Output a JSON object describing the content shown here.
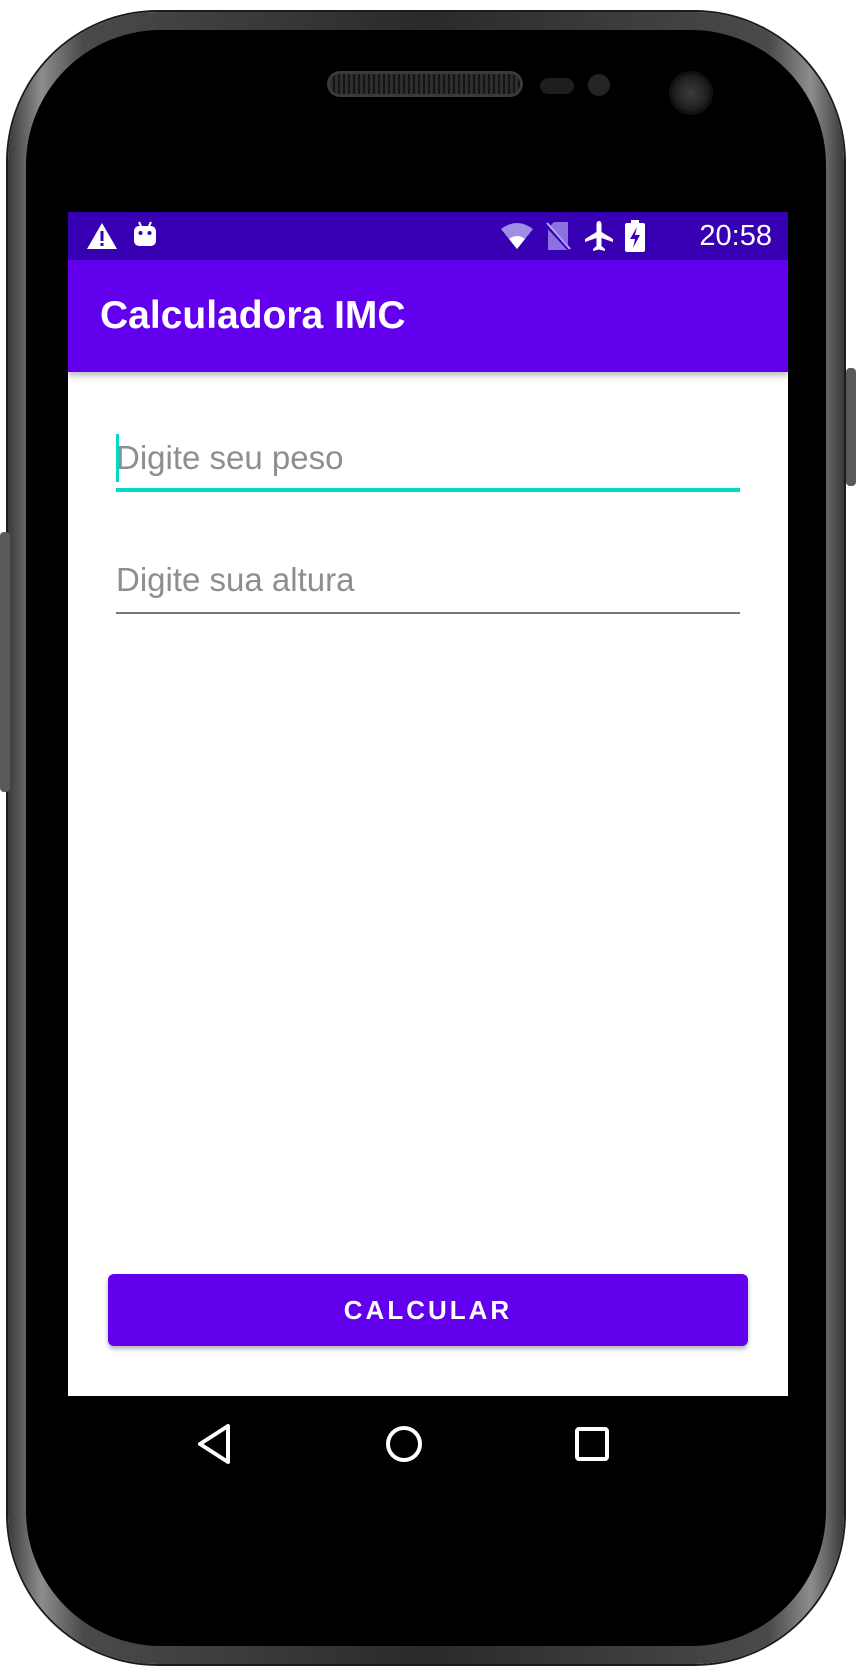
{
  "status_bar": {
    "time": "20:58",
    "icons": [
      "warning-icon",
      "android-debug-icon",
      "wifi-icon",
      "no-sim-icon",
      "airplane-mode-icon",
      "battery-charging-icon"
    ],
    "background": "#3700B3"
  },
  "app_bar": {
    "title": "Calculadora IMC",
    "background": "#6200EE"
  },
  "form": {
    "weight_placeholder": "Digite seu peso",
    "height_placeholder": "Digite sua altura",
    "focused_underline_color": "#03DAC5",
    "calculate_label": "CALCULAR"
  },
  "nav_bar": {
    "icons": [
      "back-icon",
      "home-icon",
      "recents-icon"
    ]
  }
}
